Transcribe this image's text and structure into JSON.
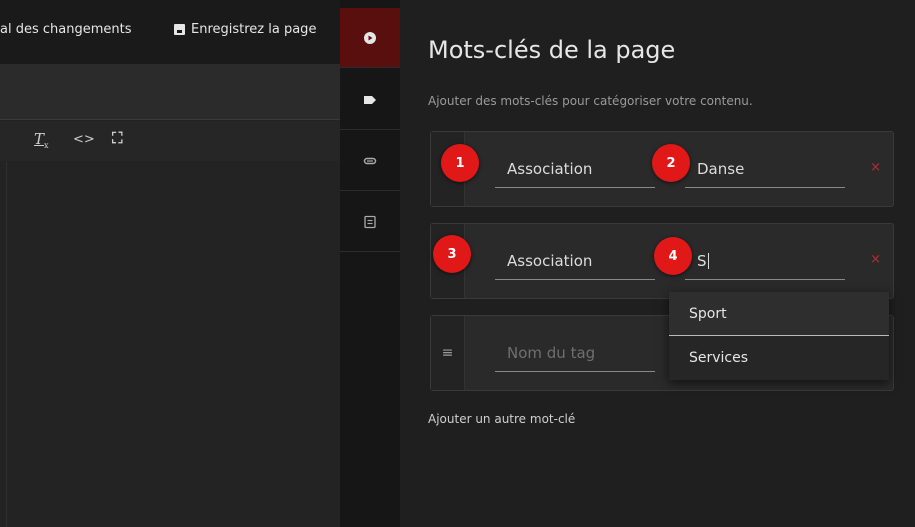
{
  "editor": {
    "history_label": "al des changements",
    "save_label": "Enregistrez la page",
    "toolbar": {
      "clear_format": "T",
      "clear_sub": "x",
      "code": "<>",
      "fullscreen": "⛶"
    }
  },
  "rail": {
    "items": [
      "play-icon",
      "tag-icon",
      "paperclip-icon",
      "form-icon"
    ],
    "active_color": "#5a0f0f"
  },
  "panel": {
    "title": "Mots-clés de la page",
    "subtitle": "Ajouter des mots-clés pour catégoriser votre contenu.",
    "tags": [
      {
        "category": "Association",
        "value": "Danse"
      },
      {
        "category": "Association",
        "value": "S"
      },
      {
        "category": "",
        "category_placeholder": "Nom du tag",
        "value": ""
      }
    ],
    "remove_symbol": "×",
    "drag_symbol": "≡",
    "add_label": "Ajouter un autre mot-clé"
  },
  "dropdown": {
    "options": [
      "Sport",
      "Services"
    ]
  },
  "badges": [
    "1",
    "2",
    "3",
    "4"
  ],
  "colors": {
    "badge": "#e01818",
    "remove": "#b03030"
  }
}
